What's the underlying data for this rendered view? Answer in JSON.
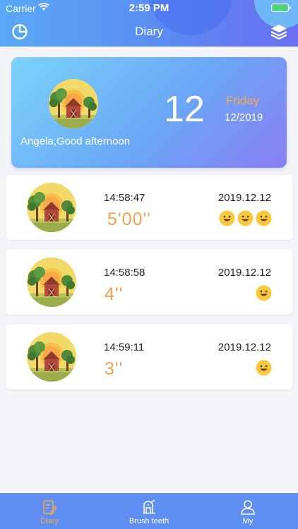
{
  "status_bar": {
    "carrier": "Carrier",
    "time": "2:59 PM"
  },
  "nav": {
    "title": "Diary",
    "left_icon": "pie-chart-icon",
    "right_icon": "layers-icon"
  },
  "hero": {
    "greeting": "Angela,Good afternoon",
    "day_number": "12",
    "weekday": "Friday",
    "month_year": "12/2019"
  },
  "entries": [
    {
      "time": "14:58:47",
      "date": "2019.12.12",
      "duration": "5'00''",
      "smileys": 3
    },
    {
      "time": "14:58:58",
      "date": "2019.12.12",
      "duration": "4''",
      "smileys": 1
    },
    {
      "time": "14:59:11",
      "date": "2019.12.12",
      "duration": "3''",
      "smileys": 1
    }
  ],
  "tabs": [
    {
      "label": "Diary",
      "icon": "diary-icon",
      "active": true
    },
    {
      "label": "Brush teeth",
      "icon": "brush-teeth-icon",
      "active": false
    },
    {
      "label": "My",
      "icon": "user-icon",
      "active": false
    }
  ],
  "colors": {
    "accent": "#efa24c",
    "header_blue": "#5b8cf3",
    "tab_bar": "#5f8ff3"
  }
}
